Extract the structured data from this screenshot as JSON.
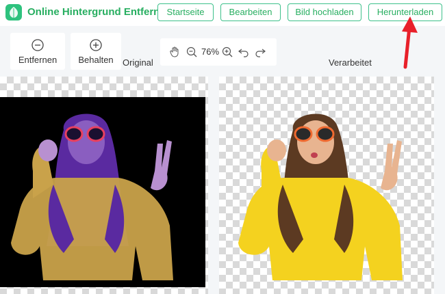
{
  "header": {
    "app_title": "Online Hintergrund Entferner",
    "nav": [
      {
        "label": "Startseite"
      },
      {
        "label": "Bearbeiten"
      },
      {
        "label": "Bild hochladen"
      },
      {
        "label": "Herunterladen"
      }
    ]
  },
  "tools": {
    "remove_label": "Entfernen",
    "keep_label": "Behalten"
  },
  "zoom": {
    "value": "76%"
  },
  "columns": {
    "original": "Original",
    "processed": "Verarbeitet"
  },
  "colors": {
    "accent": "#27ae60",
    "arrow": "#e8202a",
    "sweater": "#f4d21f",
    "sweater_tinted": "#c9a24a"
  },
  "icons": [
    "minus-circle-icon",
    "plus-circle-icon",
    "hand-icon",
    "zoom-out-icon",
    "zoom-in-icon",
    "undo-icon",
    "redo-icon"
  ]
}
